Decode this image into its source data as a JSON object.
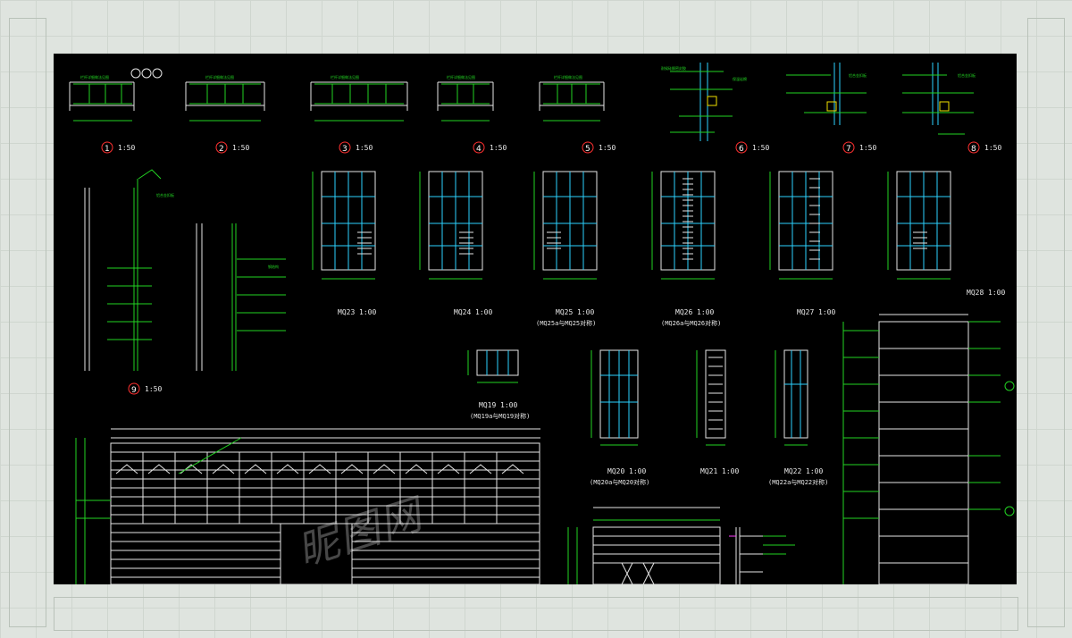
{
  "background": {
    "page_color": "#dfe4df",
    "panel_color": "#000000"
  },
  "colors": {
    "green": "#22d322",
    "white": "#e6e6e6",
    "cyan": "#2bd2ff",
    "red_callout": "#ff3030",
    "yellow": "#f0e000"
  },
  "details": [
    {
      "num": "1",
      "scale": "1:50"
    },
    {
      "num": "2",
      "scale": "1:50"
    },
    {
      "num": "3",
      "scale": "1:50"
    },
    {
      "num": "4",
      "scale": "1:50"
    },
    {
      "num": "5",
      "scale": "1:50"
    },
    {
      "num": "6",
      "scale": "1:50"
    },
    {
      "num": "7",
      "scale": "1:50"
    },
    {
      "num": "8",
      "scale": "1:50"
    },
    {
      "num": "9",
      "scale": "1:50"
    }
  ],
  "curtain_walls": [
    {
      "id": "MQ23",
      "scale": "1:00",
      "note": ""
    },
    {
      "id": "MQ24",
      "scale": "1:00",
      "note": ""
    },
    {
      "id": "MQ25",
      "scale": "1:00",
      "note": "(MQ25a与MQ25对称)"
    },
    {
      "id": "MQ26",
      "scale": "1:00",
      "note": "(MQ26a与MQ26对称)"
    },
    {
      "id": "MQ27",
      "scale": "1:00",
      "note": ""
    },
    {
      "id": "MQ28",
      "scale": "1:00",
      "note": ""
    },
    {
      "id": "MQ19",
      "scale": "1:00",
      "note": "(MQ19a与MQ19对称)"
    },
    {
      "id": "MQ20",
      "scale": "1:00",
      "note": "(MQ20a与MQ20对称)"
    },
    {
      "id": "MQ21",
      "scale": "1:00",
      "note": ""
    },
    {
      "id": "MQ22",
      "scale": "1:00",
      "note": "(MQ22a与MQ22对称)"
    }
  ],
  "watermark": "昵图网"
}
